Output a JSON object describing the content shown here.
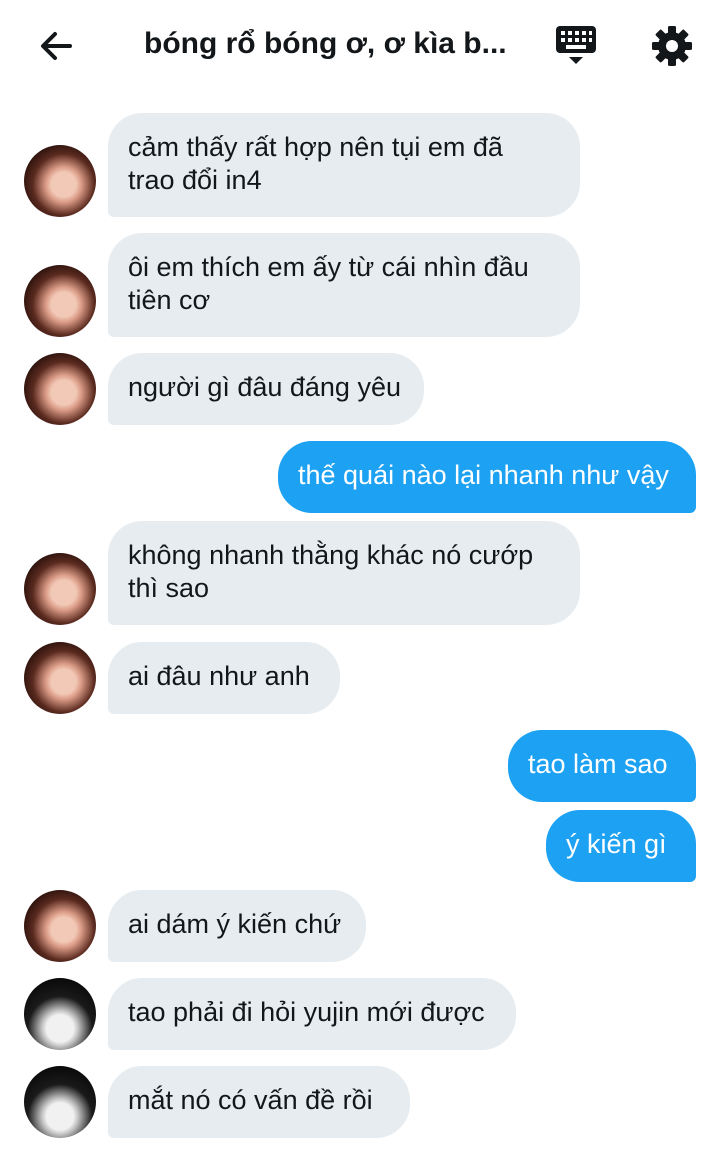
{
  "header": {
    "title": "bóng rổ bóng ơ, ơ kìa b...",
    "back_icon": "arrow-left-icon",
    "keyboard_icon": "keyboard-icon",
    "settings_icon": "gear-icon"
  },
  "colors": {
    "incoming_bubble": "#e6ecf0",
    "outgoing_bubble": "#1da1f2"
  },
  "messages": [
    {
      "side": "in",
      "avatar": "avatar-a",
      "text": "cảm thấy rất hợp nên tụi em đã\ntrao đổi in4"
    },
    {
      "side": "in",
      "avatar": "avatar-a",
      "text": "ôi em thích em ấy từ cái nhìn đầu\ntiên cơ"
    },
    {
      "side": "in",
      "avatar": "avatar-a",
      "text": "người gì đâu đáng yêu"
    },
    {
      "side": "out",
      "text": "thế quái nào lại nhanh như vậy"
    },
    {
      "side": "in",
      "avatar": "avatar-a",
      "text": "không nhanh thằng khác nó cướp\nthì sao"
    },
    {
      "side": "in",
      "avatar": "avatar-a",
      "text": "ai đâu như anh"
    },
    {
      "side": "out",
      "text": "tao làm sao"
    },
    {
      "side": "out",
      "text": "ý kiến gì"
    },
    {
      "side": "in",
      "avatar": "avatar-a",
      "text": "ai dám ý kiến chứ"
    },
    {
      "side": "in",
      "avatar": "avatar-b",
      "text": "tao phải đi hỏi yujin mới được"
    },
    {
      "side": "in",
      "avatar": "avatar-b",
      "text": "mắt nó có vấn đề rồi"
    }
  ]
}
